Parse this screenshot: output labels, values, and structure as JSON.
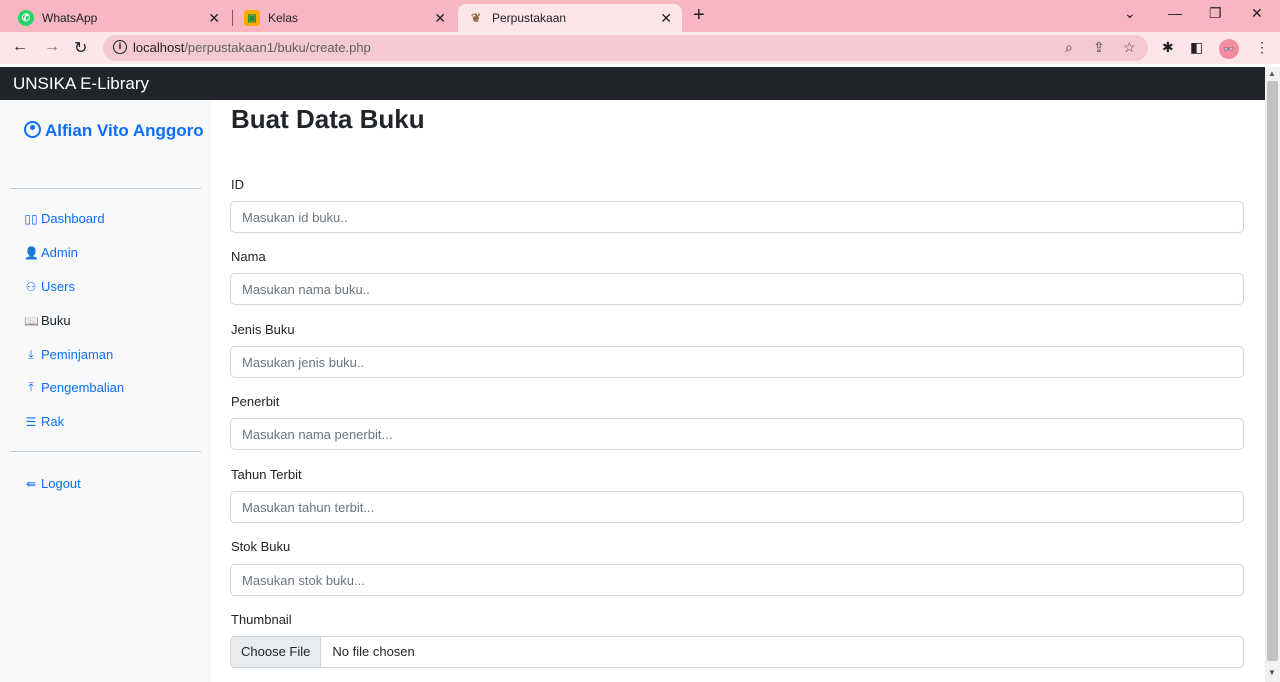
{
  "browser": {
    "tabs": [
      {
        "title": "WhatsApp"
      },
      {
        "title": "Kelas"
      },
      {
        "title": "Perpustakaan"
      }
    ],
    "url_host": "localhost",
    "url_path": "/perpustakaan1/buku/create.php"
  },
  "app": {
    "brand": "UNSIKA E-Library"
  },
  "sidebar": {
    "user_name": "Alfian Vito Anggoro",
    "items": [
      {
        "label": "Dashboard",
        "icon": "dashboard-icon"
      },
      {
        "label": "Admin",
        "icon": "admin-icon"
      },
      {
        "label": "Users",
        "icon": "users-icon"
      },
      {
        "label": "Buku",
        "icon": "book-icon"
      },
      {
        "label": "Peminjaman",
        "icon": "borrow-icon"
      },
      {
        "label": "Pengembalian",
        "icon": "return-icon"
      },
      {
        "label": "Rak",
        "icon": "shelf-icon"
      }
    ],
    "logout_label": "Logout"
  },
  "form": {
    "title": "Buat Data Buku",
    "fields": [
      {
        "label": "ID",
        "placeholder": "Masukan id buku.."
      },
      {
        "label": "Nama",
        "placeholder": "Masukan nama buku.."
      },
      {
        "label": "Jenis Buku",
        "placeholder": "Masukan jenis buku.."
      },
      {
        "label": "Penerbit",
        "placeholder": "Masukan nama penerbit..."
      },
      {
        "label": "Tahun Terbit",
        "placeholder": "Masukan tahun terbit..."
      },
      {
        "label": "Stok Buku",
        "placeholder": "Masukan stok buku..."
      }
    ],
    "thumbnail_label": "Thumbnail",
    "file_button": "Choose File",
    "file_status": "No file chosen"
  },
  "colors": {
    "tab_strip": "#f7b6c2",
    "navbar": "#212529",
    "link": "#0d6efd"
  }
}
